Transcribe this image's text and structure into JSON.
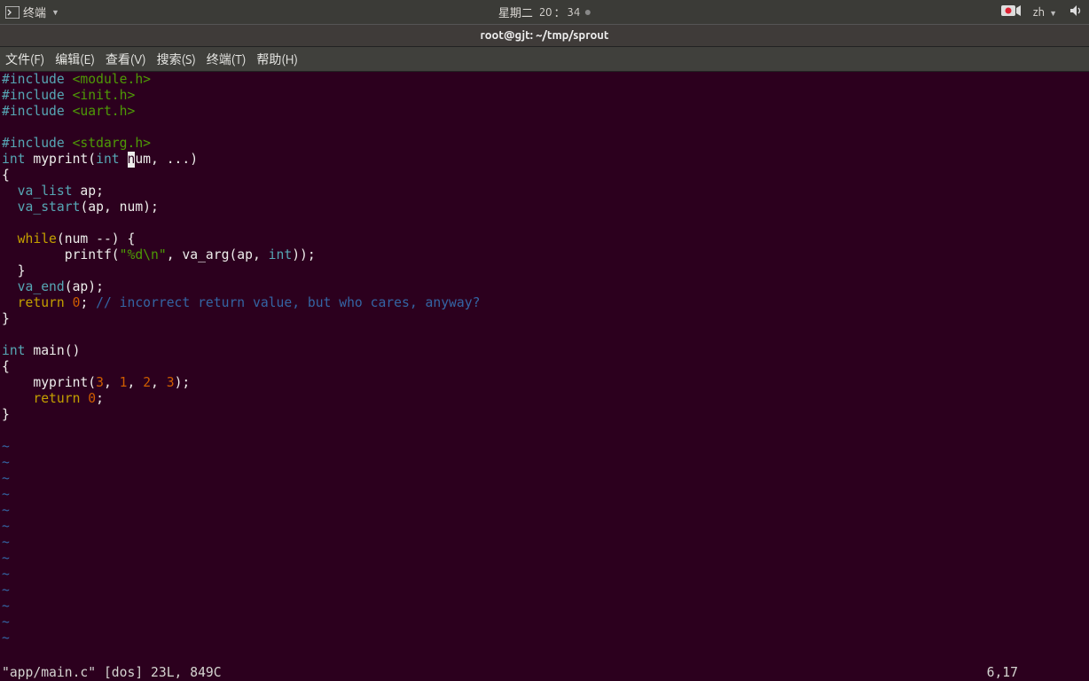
{
  "topbar": {
    "app_label": "终端",
    "day": "星期二",
    "time_h": "20",
    "time_m": "34",
    "lang": "zh"
  },
  "titlebar": {
    "text": "root@gjt: ~/tmp/sprout"
  },
  "menubar": {
    "file": "文件(F)",
    "edit": "编辑(E)",
    "view": "查看(V)",
    "search": "搜索(S)",
    "terminal": "终端(T)",
    "help": "帮助(H)"
  },
  "code": {
    "l1_inc": "#include",
    "l1_hdr": " <module.h>",
    "l2_inc": "#include",
    "l2_hdr": " <init.h>",
    "l3_inc": "#include",
    "l3_hdr": " <uart.h>",
    "l5_inc": "#include",
    "l5_hdr": " <stdarg.h>",
    "l6_int": "int",
    "l6_name": " myprint(",
    "l6_int2": "int",
    "l6_pre": " ",
    "l6_cur": "n",
    "l6_rest": "um, ...)",
    "l7": "{",
    "l8a": "  va_list",
    "l8b": " ap;",
    "l9a": "  va_start",
    "l9b": "(ap, num);",
    "l11a": "  while",
    "l11b": "(num --) {",
    "l12a": "        printf(",
    "l12b": "\"%d\\n\"",
    "l12c": ", va_arg(ap, ",
    "l12d": "int",
    "l12e": "));",
    "l13": "  }",
    "l14a": "  va_end",
    "l14b": "(ap);",
    "l15a": "  return",
    "l15b": " ",
    "l15c": "0",
    "l15d": ";",
    "l15e": " // incorrect return value, but who cares, anyway?",
    "l16": "}",
    "l18a": "int",
    "l18b": " main()",
    "l19": "{",
    "l20a": "    myprint(",
    "l20b": "3",
    "l20c": ", ",
    "l20d": "1",
    "l20e": ", ",
    "l20f": "2",
    "l20g": ", ",
    "l20h": "3",
    "l20i": ");",
    "l21a": "    return",
    "l21b": " ",
    "l21c": "0",
    "l21d": ";",
    "l22": "}",
    "tilde": "~"
  },
  "status": {
    "left": "\"app/main.c\" [dos] 23L, 849C",
    "pos": "6,17"
  }
}
